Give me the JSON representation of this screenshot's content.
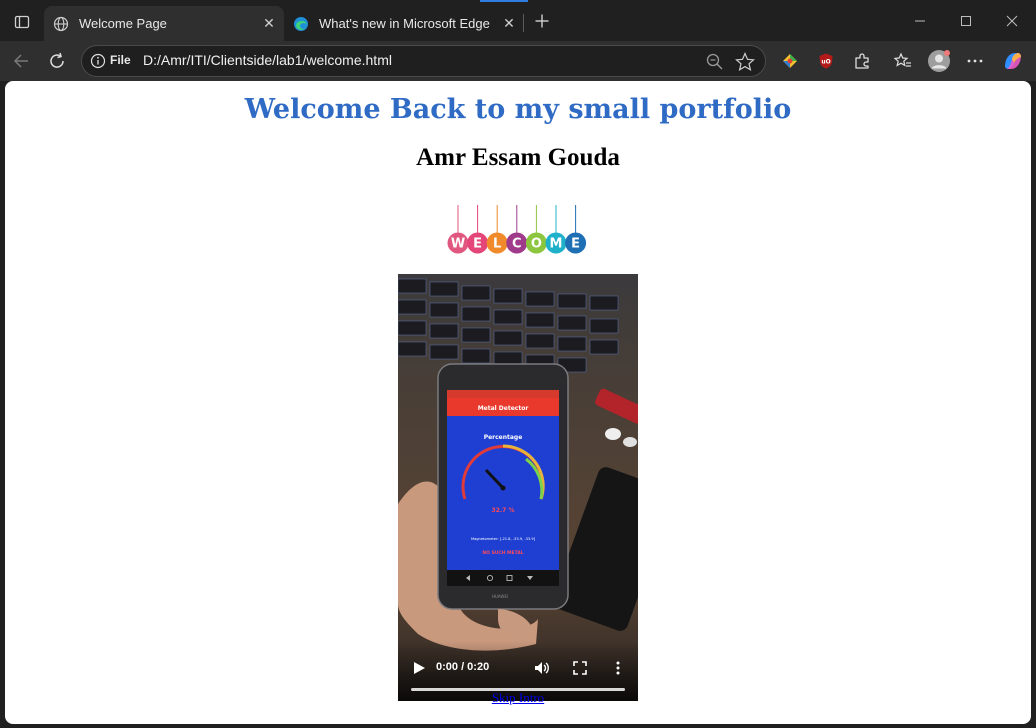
{
  "browser": {
    "tabs": [
      {
        "title": "Welcome Page",
        "active": true,
        "icon": "globe-icon"
      },
      {
        "title": "What's new in Microsoft Edge",
        "active": false,
        "icon": "edge-icon"
      }
    ],
    "address_bar": {
      "scheme_label": "File",
      "url": "D:/Amr/ITI/Clientside/lab1/welcome.html"
    },
    "accent_color": "#2f7de1"
  },
  "page": {
    "heading": "Welcome Back to my small portfolio",
    "subheading": "Amr Essam Gouda",
    "welcome_image": {
      "letters": [
        "W",
        "E",
        "L",
        "C",
        "O",
        "M",
        "E"
      ],
      "colors": [
        "#e2577f",
        "#e5467a",
        "#f08a2a",
        "#a03b8c",
        "#8cc63f",
        "#1fb1c9",
        "#1f6fb5"
      ]
    },
    "video": {
      "time_display": "0:00 / 0:20",
      "progress": 0,
      "screen_title": "Metal Detector",
      "screen_label": "Percentage",
      "screen_value": "32.7 %",
      "screen_readout": "Magnetometer: [-21.8, -33.9, -33.9]",
      "screen_status": "NO SUCH METAL",
      "phone_brand": "HUAWEI"
    },
    "skip_link": "Skip Intro"
  },
  "colors": {
    "heading": "#2f6bc5",
    "link": "#0000ee"
  }
}
